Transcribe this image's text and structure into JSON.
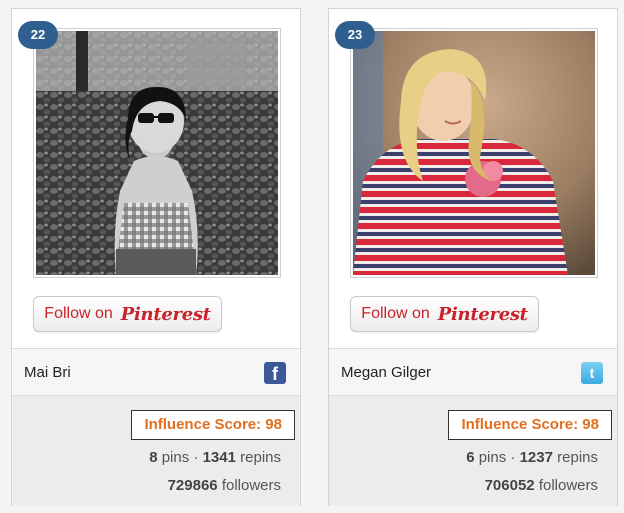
{
  "cards": [
    {
      "rank": "22",
      "follow": {
        "label": "Follow on",
        "brand": "Pinterest"
      },
      "name": "Mai Bri",
      "social_icon": "facebook-icon",
      "influence": "Influence Score: 98",
      "pins": "8",
      "pins_label": "pins",
      "sep": "·",
      "repins": "1341",
      "repins_label": "repins",
      "followers": "729866",
      "followers_label": "followers"
    },
    {
      "rank": "23",
      "follow": {
        "label": "Follow on",
        "brand": "Pinterest"
      },
      "name": "Megan Gilger",
      "social_icon": "twitter-icon",
      "influence": "Influence Score: 98",
      "pins": "6",
      "pins_label": "pins",
      "sep": "·",
      "repins": "1237",
      "repins_label": "repins",
      "followers": "706052",
      "followers_label": "followers"
    }
  ],
  "colors": {
    "rank_badge": "#2f5f8e",
    "pinterest_red": "#c8232c",
    "influence_orange": "#e0701f",
    "facebook_blue": "#3b5998",
    "twitter_blue": "#3aa9e0"
  }
}
